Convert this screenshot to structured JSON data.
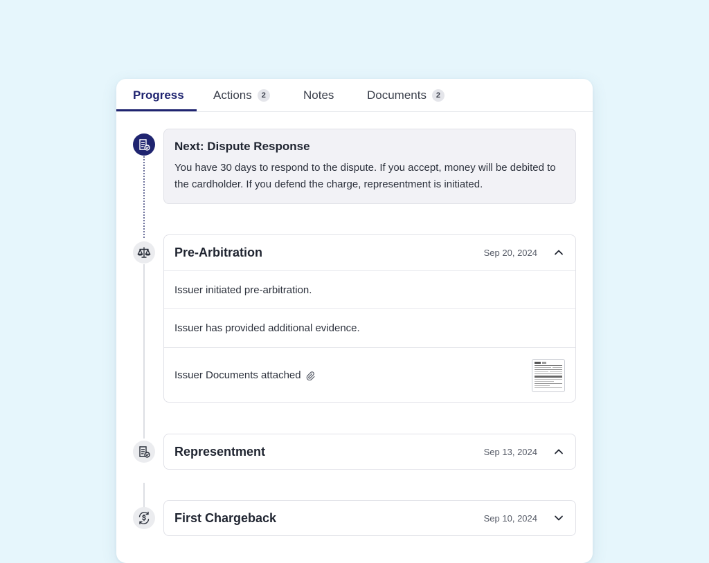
{
  "tabs": [
    {
      "label": "Progress",
      "badge": null
    },
    {
      "label": "Actions",
      "badge": "2"
    },
    {
      "label": "Notes",
      "badge": null
    },
    {
      "label": "Documents",
      "badge": "2"
    }
  ],
  "next": {
    "title": "Next: Dispute Response",
    "text": "You have 30 days to respond to the dispute. If you accept, money will be debited to the cardholder. If you defend the charge, representment is initiated."
  },
  "steps": [
    {
      "title": "Pre-Arbitration",
      "date": "Sep 20, 2024",
      "expanded": true,
      "rows": [
        "Issuer initiated pre-arbitration.",
        "Issuer has provided additional evidence.",
        "Issuer Documents attached"
      ]
    },
    {
      "title": "Representment",
      "date": "Sep 13, 2024",
      "expanded": true
    },
    {
      "title": "First Chargeback",
      "date": "Sep 10, 2024",
      "expanded": false
    }
  ],
  "colors": {
    "accent": "#1f2470",
    "background": "#e6f6fc",
    "panel": "#f2f2f6"
  },
  "icons": {
    "next": "document-check-icon",
    "pre_arbitration": "scales-icon",
    "representment": "document-check-icon",
    "first_chargeback": "currency-exchange-icon",
    "attachment": "paperclip-icon"
  }
}
